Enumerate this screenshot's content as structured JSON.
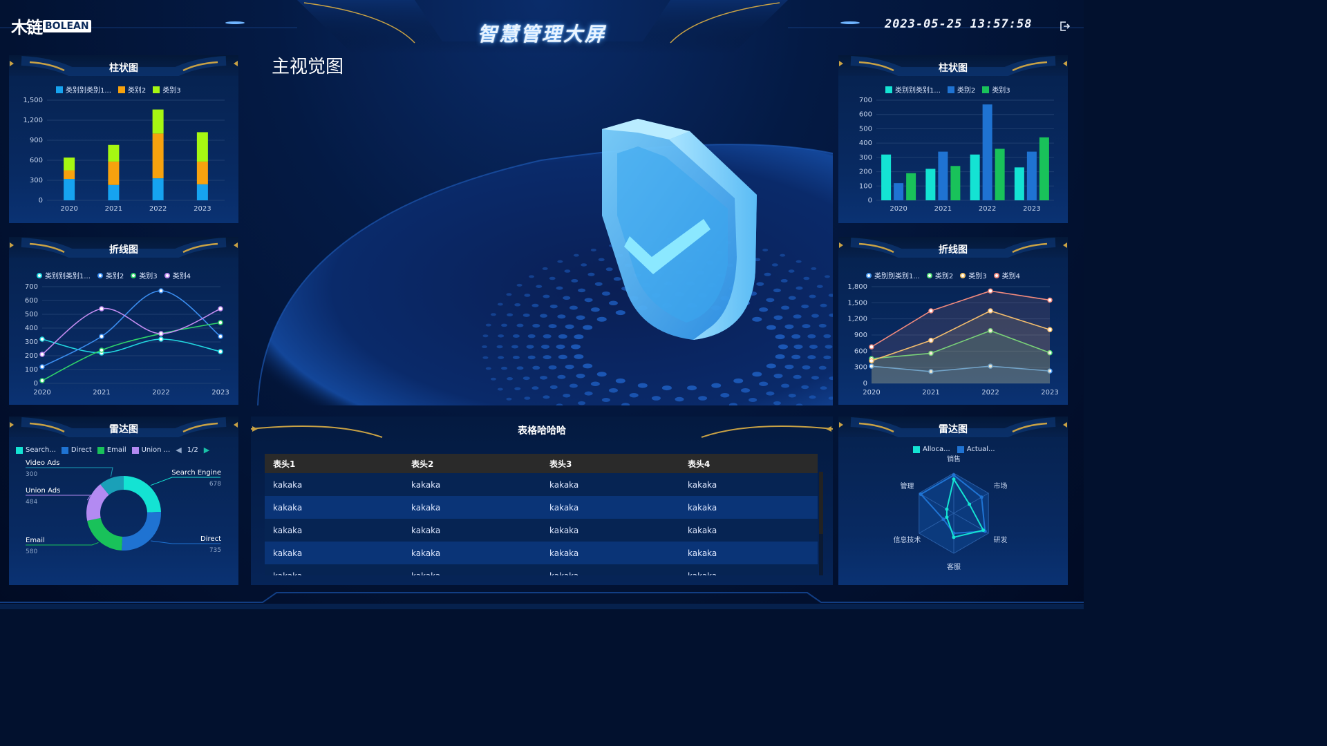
{
  "header": {
    "logo_cn": "木链",
    "logo_en": "BOLEAN",
    "title": "智慧管理大屏",
    "datetime": "2023-05-25 13:57:58"
  },
  "colors": {
    "bg": "#02112e",
    "cyan": "#14e3d3",
    "blue": "#1f73d2",
    "orange": "#f7a20e",
    "lime": "#a6f712",
    "green": "#19c25a",
    "gold": "#c9a245"
  },
  "panels": {
    "bar_left_title": "柱状图",
    "line_left_title": "折线图",
    "radar_left_title": "雷达图",
    "bar_right_title": "柱状图",
    "line_right_title": "折线图",
    "radar_right_title": "雷达图",
    "main_title": "主视觉图",
    "table_title": "表格哈哈哈"
  },
  "chart_data": [
    {
      "id": "bar-left",
      "type": "bar",
      "stacked": true,
      "categories": [
        "2020",
        "2021",
        "2022",
        "2023"
      ],
      "series": [
        {
          "name": "类别别类别1...",
          "color": "#16a3f0",
          "values": [
            320,
            230,
            330,
            240
          ]
        },
        {
          "name": "类别2",
          "color": "#f7a20e",
          "values": [
            130,
            350,
            670,
            340
          ]
        },
        {
          "name": "类别3",
          "color": "#a6f712",
          "values": [
            190,
            250,
            360,
            440
          ]
        }
      ],
      "ylim": [
        0,
        1500
      ],
      "yticks": [
        0,
        300,
        600,
        900,
        1200,
        1500
      ],
      "ytick_labels": [
        "0",
        "300",
        "600",
        "900",
        "1,200",
        "1,500"
      ]
    },
    {
      "id": "bar-right",
      "type": "bar",
      "stacked": false,
      "categories": [
        "2020",
        "2021",
        "2022",
        "2023"
      ],
      "series": [
        {
          "name": "类别别类别1...",
          "color": "#14e3d3",
          "values": [
            320,
            220,
            320,
            230
          ]
        },
        {
          "name": "类别2",
          "color": "#1f73d2",
          "values": [
            120,
            340,
            670,
            340
          ]
        },
        {
          "name": "类别3",
          "color": "#19c25a",
          "values": [
            190,
            240,
            360,
            440
          ]
        }
      ],
      "ylim": [
        0,
        700
      ],
      "yticks": [
        0,
        100,
        200,
        300,
        400,
        500,
        600,
        700
      ],
      "ytick_labels": [
        "0",
        "100",
        "200",
        "300",
        "400",
        "500",
        "600",
        "700"
      ]
    },
    {
      "id": "line-left",
      "type": "line",
      "smooth": true,
      "x": [
        "2020",
        "2021",
        "2022",
        "2023"
      ],
      "series": [
        {
          "name": "类别别类别1...",
          "color": "#22d8e0",
          "values": [
            320,
            220,
            320,
            230
          ]
        },
        {
          "name": "类别2",
          "color": "#3b8ef0",
          "values": [
            120,
            340,
            670,
            340
          ]
        },
        {
          "name": "类别3",
          "color": "#2fd46a",
          "values": [
            20,
            240,
            360,
            440
          ]
        },
        {
          "name": "类别4",
          "color": "#c28cf0",
          "values": [
            210,
            540,
            360,
            540
          ]
        }
      ],
      "ylim": [
        0,
        700
      ],
      "yticks": [
        0,
        100,
        200,
        300,
        400,
        500,
        600,
        700
      ],
      "ytick_labels": [
        "0",
        "100",
        "200",
        "300",
        "400",
        "500",
        "600",
        "700"
      ]
    },
    {
      "id": "line-right",
      "type": "area",
      "x": [
        "2020",
        "2021",
        "2022",
        "2023"
      ],
      "series": [
        {
          "name": "类别别类别1...",
          "color": "#4a9af0",
          "values": [
            320,
            220,
            320,
            230
          ]
        },
        {
          "name": "类别2",
          "color": "#57e07a",
          "values": [
            460,
            560,
            980,
            570
          ]
        },
        {
          "name": "类别3",
          "color": "#f6c56b",
          "values": [
            420,
            800,
            1350,
            1000
          ]
        },
        {
          "name": "类别4",
          "color": "#f28a7d",
          "values": [
            680,
            1350,
            1720,
            1550
          ]
        }
      ],
      "ylim": [
        0,
        1800
      ],
      "yticks": [
        0,
        300,
        600,
        900,
        1200,
        1500,
        1800
      ],
      "ytick_labels": [
        "0",
        "300",
        "600",
        "900",
        "1,200",
        "1,500",
        "1,800"
      ]
    },
    {
      "id": "donut-left",
      "type": "pie",
      "legend_page": "1/2",
      "legend": [
        "Search...",
        "Direct",
        "Email",
        "Union ..."
      ],
      "slices": [
        {
          "name": "Search Engine",
          "value": 678,
          "color": "#14e3d3"
        },
        {
          "name": "Direct",
          "value": 735,
          "color": "#1f73d2"
        },
        {
          "name": "Email",
          "value": 580,
          "color": "#19c25a"
        },
        {
          "name": "Union Ads",
          "value": 484,
          "color": "#b38af2"
        },
        {
          "name": "Video Ads",
          "value": 300,
          "color": "#1aa0b8"
        }
      ]
    },
    {
      "id": "radar-right",
      "type": "radar",
      "indicators": [
        "销售",
        "市场",
        "研发",
        "客服",
        "信息技术",
        "管理"
      ],
      "series": [
        {
          "name": "Alloca...",
          "color": "#14e3d3",
          "values": [
            0.85,
            0.45,
            0.85,
            0.6,
            0.2,
            0.2
          ]
        },
        {
          "name": "Actual...",
          "color": "#1f73d2",
          "values": [
            0.95,
            0.8,
            0.9,
            0.5,
            0.3,
            0.95
          ]
        }
      ]
    }
  ],
  "table": {
    "headers": [
      "表头1",
      "表头2",
      "表头3",
      "表头4"
    ],
    "rows": [
      [
        "kakaka",
        "kakaka",
        "kakaka",
        "kakaka"
      ],
      [
        "kakaka",
        "kakaka",
        "kakaka",
        "kakaka"
      ],
      [
        "kakaka",
        "kakaka",
        "kakaka",
        "kakaka"
      ],
      [
        "kakaka",
        "kakaka",
        "kakaka",
        "kakaka"
      ],
      [
        "kakaka",
        "kakaka",
        "kakaka",
        "kakaka"
      ]
    ]
  }
}
